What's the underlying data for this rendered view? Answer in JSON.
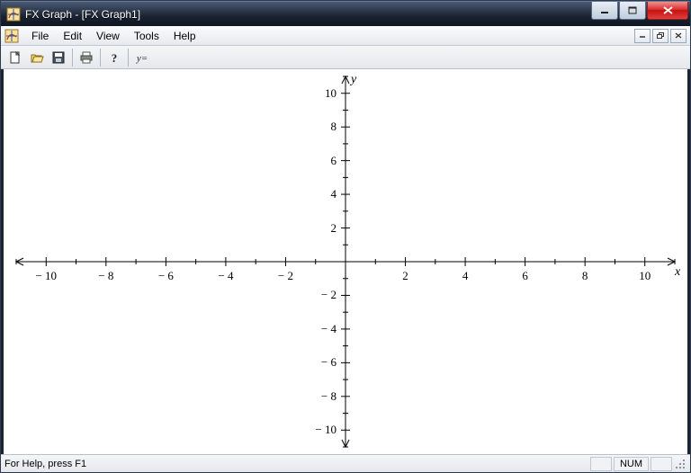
{
  "titlebar": {
    "text": "FX Graph - [FX Graph1]"
  },
  "menu": {
    "items": [
      "File",
      "Edit",
      "View",
      "Tools",
      "Help"
    ]
  },
  "toolbar": {
    "icons": [
      "new",
      "open",
      "save",
      "print",
      "help",
      "function"
    ]
  },
  "statusbar": {
    "hint": "For Help, press F1",
    "num": "NUM"
  },
  "chart_data": {
    "type": "scatter",
    "title": "",
    "xlabel": "x",
    "ylabel": "y",
    "xlim": [
      -11,
      11
    ],
    "ylim": [
      -11,
      11
    ],
    "x_major_ticks": [
      -10,
      -8,
      -6,
      -4,
      -2,
      2,
      4,
      6,
      8,
      10
    ],
    "y_major_ticks": [
      -10,
      -8,
      -6,
      -4,
      -2,
      2,
      4,
      6,
      8,
      10
    ],
    "minor_tick_step": 1,
    "series": [],
    "grid": false,
    "legend": false
  }
}
